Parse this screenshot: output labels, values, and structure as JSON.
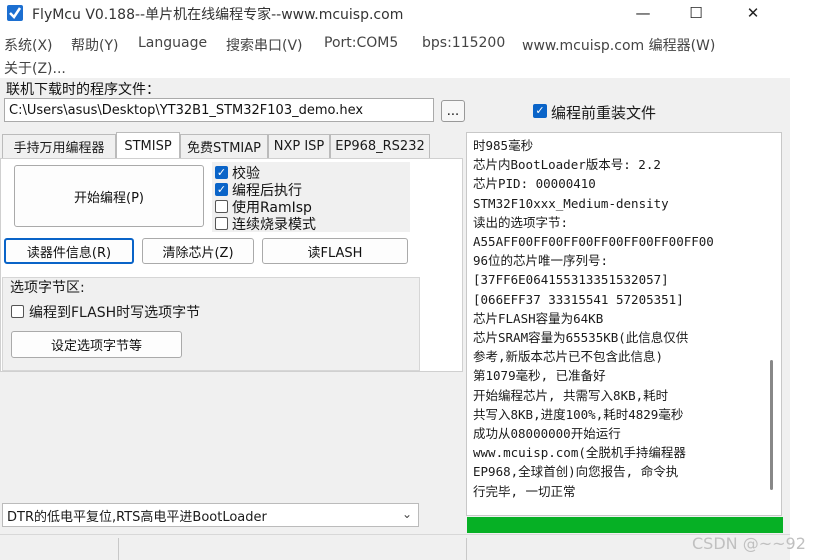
{
  "window": {
    "title": "FlyMcu V0.188--单片机在线编程专家--www.mcuisp.com",
    "minimize_glyph": "—",
    "maximize_glyph": "☐",
    "close_glyph": "✕"
  },
  "menu": {
    "items": [
      "系统(X)",
      "帮助(Y)",
      "Language",
      "搜索串口(V)",
      "Port:COM5",
      "bps:115200",
      "www.mcuisp.com 编程器(W)"
    ],
    "about": "关于(Z)..."
  },
  "file": {
    "label": "联机下载时的程序文件：",
    "path": "C:\\Users\\asus\\Desktop\\YT32B1_STM32F103_demo.hex",
    "browse_label": "...",
    "reload_label": "编程前重装文件",
    "reload_checked": true
  },
  "tabs": [
    "手持万用编程器",
    "STMISP",
    "免费STMIAP",
    "NXP ISP",
    "EP968_RS232"
  ],
  "active_tab": "STMISP",
  "stmisp": {
    "start_label": "开始编程(P)",
    "options": [
      {
        "label": "校验",
        "checked": true
      },
      {
        "label": "编程后执行",
        "checked": true
      },
      {
        "label": "使用RamIsp",
        "checked": false
      },
      {
        "label": "连续烧录模式",
        "checked": false
      }
    ],
    "read_info_label": "读器件信息(R)",
    "erase_label": "清除芯片(Z)",
    "read_flash_label": "读FLASH"
  },
  "option_bytes": {
    "title": "选项字节区:",
    "write_label": "编程到FLASH时写选项字节",
    "write_checked": false,
    "set_label": "设定选项字节等"
  },
  "bootloader_mode": "DTR的低电平复位,RTS高电平进BootLoader",
  "log": {
    "lines": [
      "时985毫秒",
      "芯片内BootLoader版本号: 2.2",
      "芯片PID: 00000410",
      "STM32F10xxx_Medium-density",
      "读出的选项字节:",
      "A55AFF00FF00FF00FF00FF00FF00FF00",
      "96位的芯片唯一序列号:",
      "[37FF6E064155313351532057]",
      "[066EFF37 33315541 57205351]",
      "芯片FLASH容量为64KB",
      "芯片SRAM容量为65535KB(此信息仅供",
      "参考,新版本芯片已不包含此信息)",
      "第1079毫秒, 已准备好",
      "开始编程芯片, 共需写入8KB,耗时",
      "共写入8KB,进度100%,耗时4829毫秒",
      "成功从08000000开始运行",
      "www.mcuisp.com(全脱机手持编程器",
      "EP968,全球首创)向您报告, 命令执",
      "行完毕, 一切正常"
    ],
    "progress": 1.0
  },
  "watermark": "CSDN @~~92",
  "colors": {
    "accent": "#0a64c8",
    "progress_green": "#06b025"
  },
  "icons": {
    "app": "flymcu-app-icon",
    "dropdown": "chevron-down-icon"
  }
}
